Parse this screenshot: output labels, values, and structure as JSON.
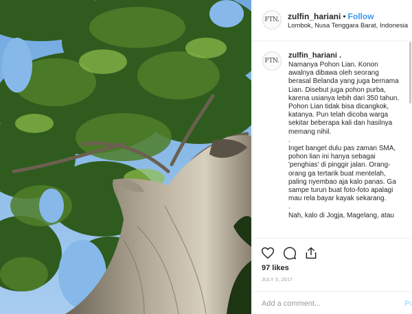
{
  "post": {
    "username": "zulfin_hariani",
    "follow_label": "Follow",
    "separator": "•",
    "location": "Lombok, Nusa Tenggara Barat, Indonesia",
    "avatar_text": "FTN.",
    "caption_username": "zulfin_hariani .",
    "caption_lines": [
      "Namanya Pohon Lian. Konon",
      "awalnya dibawa oleh seorang",
      "berasal Belanda yang juga bernama",
      "Lian. Disebut juga pohon purba,",
      "karena usianya lebih dari 350 tahun.",
      "Pohon Lian tidak bisa dicangkok,",
      "katanya. Pun telah dicoba warga",
      "sekitar beberapa kali dan hasilnya",
      "memang nihil.",
      ".",
      "Inget banget dulu pas zaman SMA,",
      "pohon lian ini hanya sebagai",
      "'penghias' di pinggir jalan. Orang-",
      "orang ga tertarik buat mentelah,",
      "paling nyembao aja kalo panas. Ga",
      "sampe turun buat foto-foto apalagi",
      "mau rela bayar kayak sekarang.",
      ".",
      "Nah, kalo di Jogja, Magelang, atau"
    ],
    "likes": "97 likes",
    "date": "JULY 3, 2017",
    "comment_placeholder": "Add a comment...",
    "post_label": "Po"
  },
  "icons": {
    "like": "heart-icon",
    "comment": "comment-bubble-icon",
    "share": "share-icon"
  },
  "colors": {
    "accent": "#3897f0",
    "sky": "#7db4e6",
    "foliage": "#2f5b1f"
  }
}
